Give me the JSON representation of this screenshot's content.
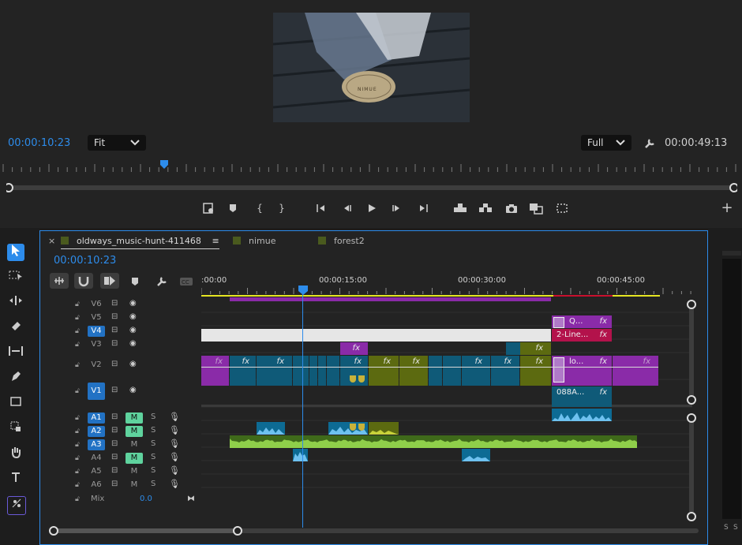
{
  "monitor": {
    "current_timecode": "00:00:10:23",
    "zoom_value": "Fit",
    "resolution_value": "Full",
    "duration_timecode": "00:00:49:13",
    "video_caption": "NIMUE",
    "controls": [
      "add-marker",
      "mark-in",
      "mark-out",
      "go-to-in",
      "step-back",
      "play",
      "step-forward",
      "go-to-out",
      "lift",
      "extract",
      "export-frame",
      "comparison-view",
      "button-editor",
      "add-button"
    ]
  },
  "timeline": {
    "tabs": [
      {
        "label": "oldways_music-hunt-411468",
        "color": "#4a5a1e",
        "active": true
      },
      {
        "label": "nimue",
        "color": "#4a5a1e",
        "active": false
      },
      {
        "label": "forest2",
        "color": "#4a5a1e",
        "active": false
      }
    ],
    "close_glyph": "×",
    "menu_glyph": "≡",
    "timecode": "00:00:10:23",
    "ruler_labels": [
      ":00:00",
      "00:00:15:00",
      "00:00:30:00",
      "00:00:45:00"
    ],
    "video_tracks": [
      "V6",
      "V5",
      "V4",
      "V3",
      "V2",
      "V1"
    ],
    "audio_tracks": [
      "A1",
      "A2",
      "A3",
      "A4",
      "A5",
      "A6"
    ],
    "mix_label": "Mix",
    "mix_value": "0.0",
    "mute_label": "M",
    "solo_label": "S",
    "clip_labels": {
      "v5": "Q...",
      "v4": "2-Line...",
      "v2": "lo...",
      "v1": "088A...",
      "fx": "fx"
    },
    "vu_labels": [
      "S",
      "S"
    ]
  },
  "colors": {
    "accent": "#2d8ceb",
    "video_clip": "#0f5a78",
    "graphics_clip": "#8a2ba8",
    "title_clip": "#b3124b",
    "audio_clip": "#0d6b94",
    "olive_clip": "#5c6a10",
    "music_clip": "#3f6a1a"
  }
}
